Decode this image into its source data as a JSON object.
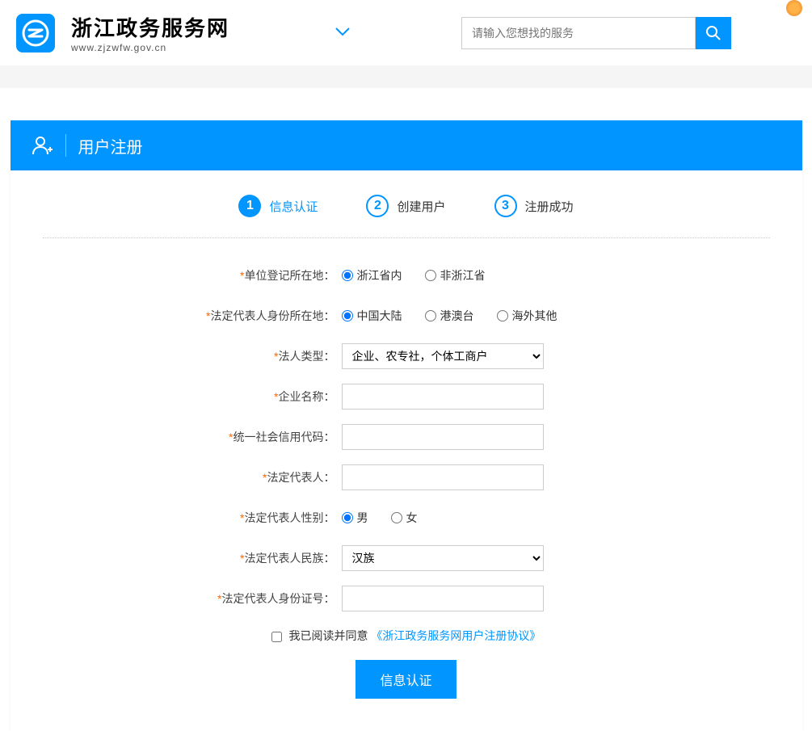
{
  "header": {
    "site_title": "浙江政务服务网",
    "site_url": "www.zjzwfw.gov.cn",
    "search_placeholder": "请输入您想找的服务"
  },
  "page": {
    "title": "用户注册"
  },
  "steps": [
    {
      "num": "1",
      "label": "信息认证"
    },
    {
      "num": "2",
      "label": "创建用户"
    },
    {
      "num": "3",
      "label": "注册成功"
    }
  ],
  "form": {
    "location": {
      "label": "单位登记所在地：",
      "options": [
        "浙江省内",
        "非浙江省"
      ],
      "selected": "浙江省内"
    },
    "id_location": {
      "label": "法定代表人身份所在地：",
      "options": [
        "中国大陆",
        "港澳台",
        "海外其他"
      ],
      "selected": "中国大陆"
    },
    "legal_type": {
      "label": "法人类型：",
      "value": "企业、农专社，个体工商户"
    },
    "company_name": {
      "label": "企业名称："
    },
    "credit_code": {
      "label": "统一社会信用代码："
    },
    "rep_name": {
      "label": "法定代表人："
    },
    "gender": {
      "label": "法定代表人性别：",
      "options": [
        "男",
        "女"
      ],
      "selected": "男"
    },
    "ethnicity": {
      "label": "法定代表人民族：",
      "value": "汉族"
    },
    "id_number": {
      "label": "法定代表人身份证号："
    }
  },
  "agreement": {
    "text": "我已阅读并同意",
    "link": "《浙江政务服务网用户注册协议》"
  },
  "submit": {
    "label": "信息认证"
  }
}
